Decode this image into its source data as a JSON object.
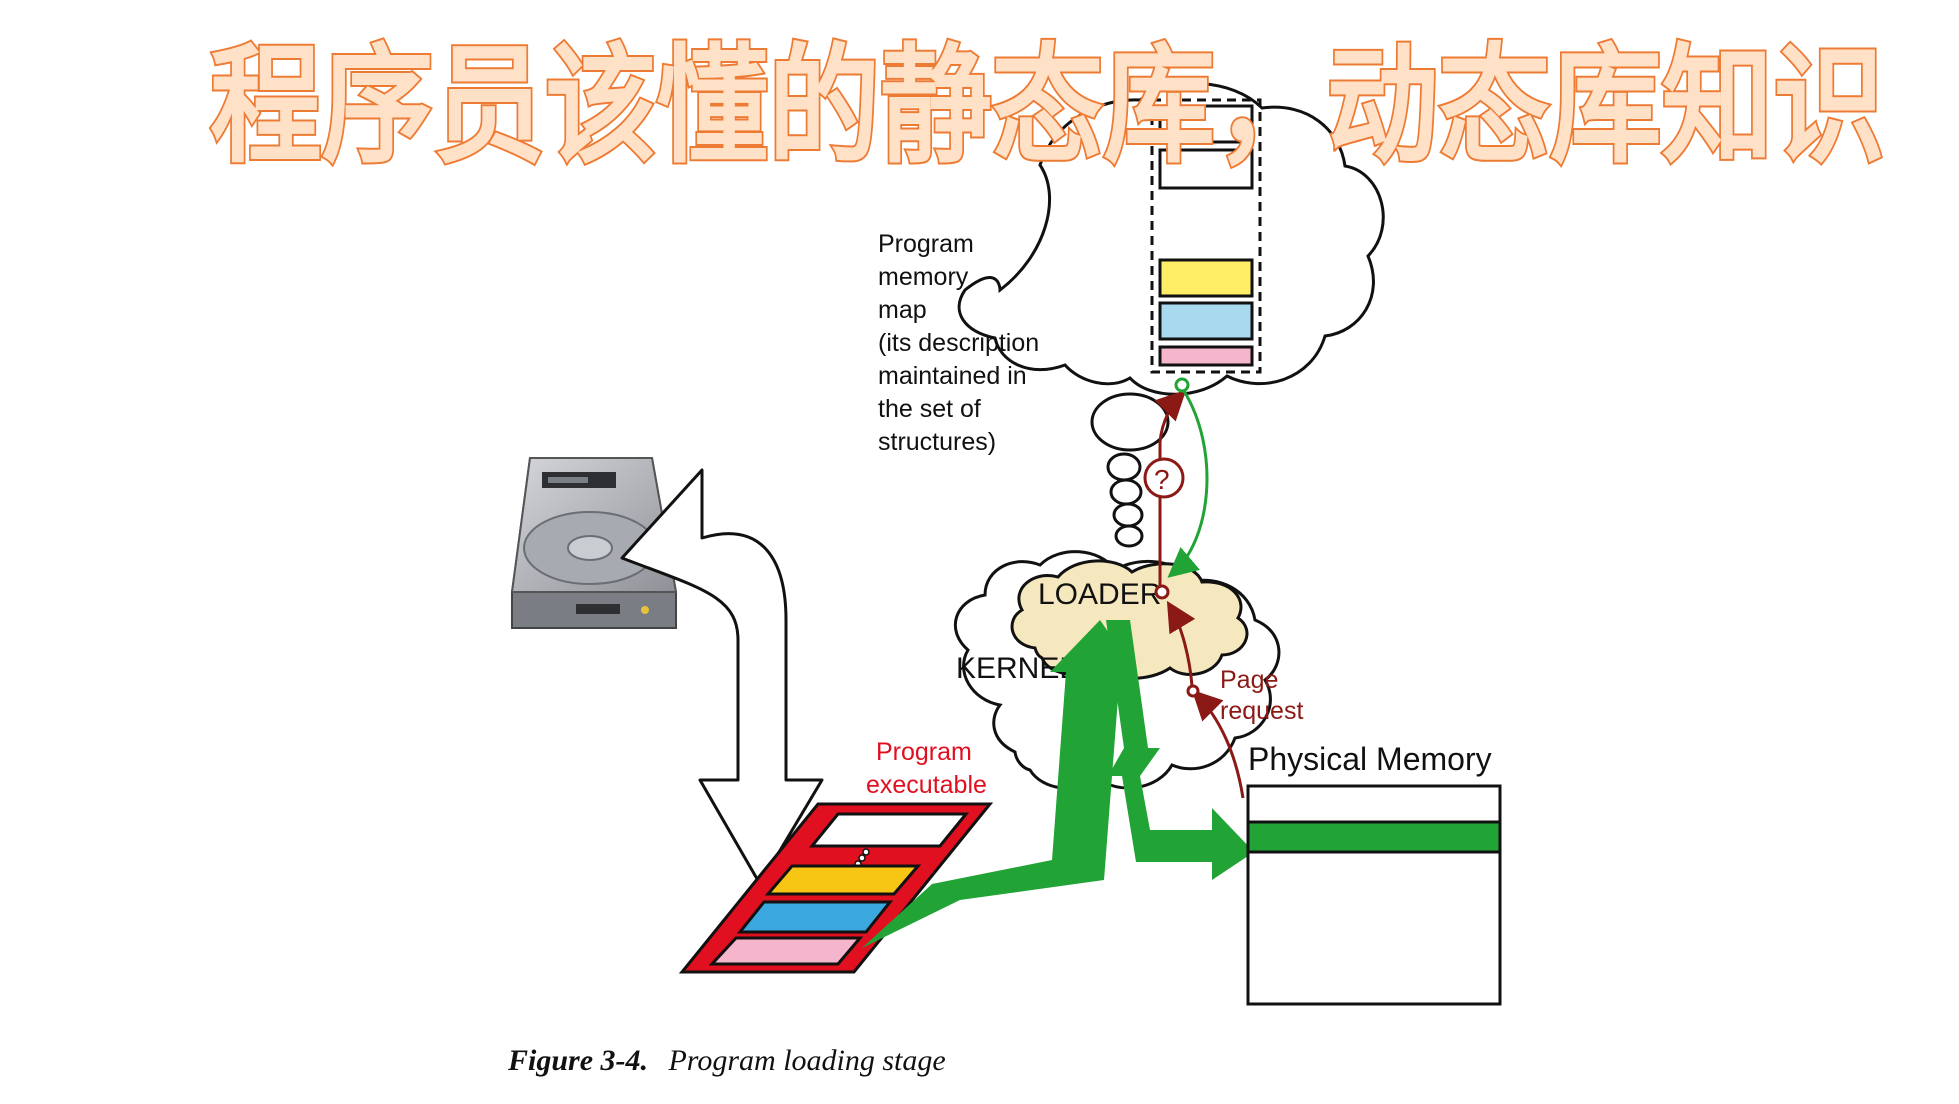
{
  "banner": {
    "title": "程序员该懂的静态库，动态库知识"
  },
  "labels": {
    "memory_map": [
      "Program",
      "memory",
      "map",
      "(its description",
      "maintained in",
      "the set of",
      "structures)"
    ],
    "loader": "LOADER",
    "kernel": "KERNEL",
    "question": "?",
    "page_request": [
      "Page",
      "request"
    ],
    "program_executable": [
      "Program",
      "executable"
    ],
    "physical_memory": "Physical Memory"
  },
  "caption": {
    "figure": "Figure 3-4.",
    "text": "Program loading stage"
  },
  "colors": {
    "banner_fill": "#ffe1c8",
    "banner_stroke": "#ee7b33",
    "green": "#21a336",
    "dark_red": "#8b1a16",
    "exec_red": "#e01020",
    "yellow": "#ffee66",
    "blue": "#a9d9ef",
    "pink": "#f5b5cc",
    "loader_cloud": "#f6e8be"
  }
}
